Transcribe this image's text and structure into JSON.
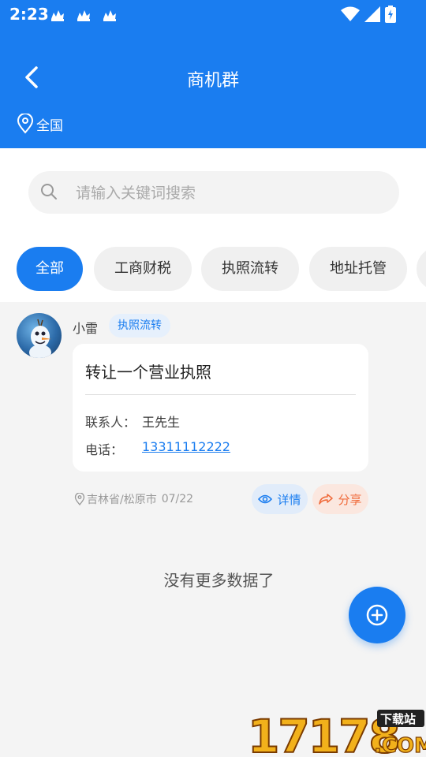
{
  "status_bar": {
    "time": "2:23"
  },
  "header": {
    "title": "商机群",
    "location": "全国"
  },
  "search": {
    "placeholder": "请输入关键词搜索",
    "value": ""
  },
  "tabs": [
    {
      "label": "全部",
      "active": true
    },
    {
      "label": "工商财税",
      "active": false
    },
    {
      "label": "执照流转",
      "active": false
    },
    {
      "label": "地址托管",
      "active": false
    }
  ],
  "post": {
    "username": "小雷",
    "tag": "执照流转",
    "title": "转让一个营业执照",
    "contact_label": "联系人：",
    "contact_name": "王先生",
    "phone_label": "电话：",
    "phone": "13311112222",
    "location": "吉林省/松原市",
    "date": "07/22",
    "detail_label": "详情",
    "share_label": "分享"
  },
  "list_end_text": "没有更多数据了",
  "watermark": {
    "number": "17178",
    "sub": "下载站",
    "domain": ".COM"
  },
  "colors": {
    "primary": "#1a7df0",
    "share": "#f06a3a"
  }
}
